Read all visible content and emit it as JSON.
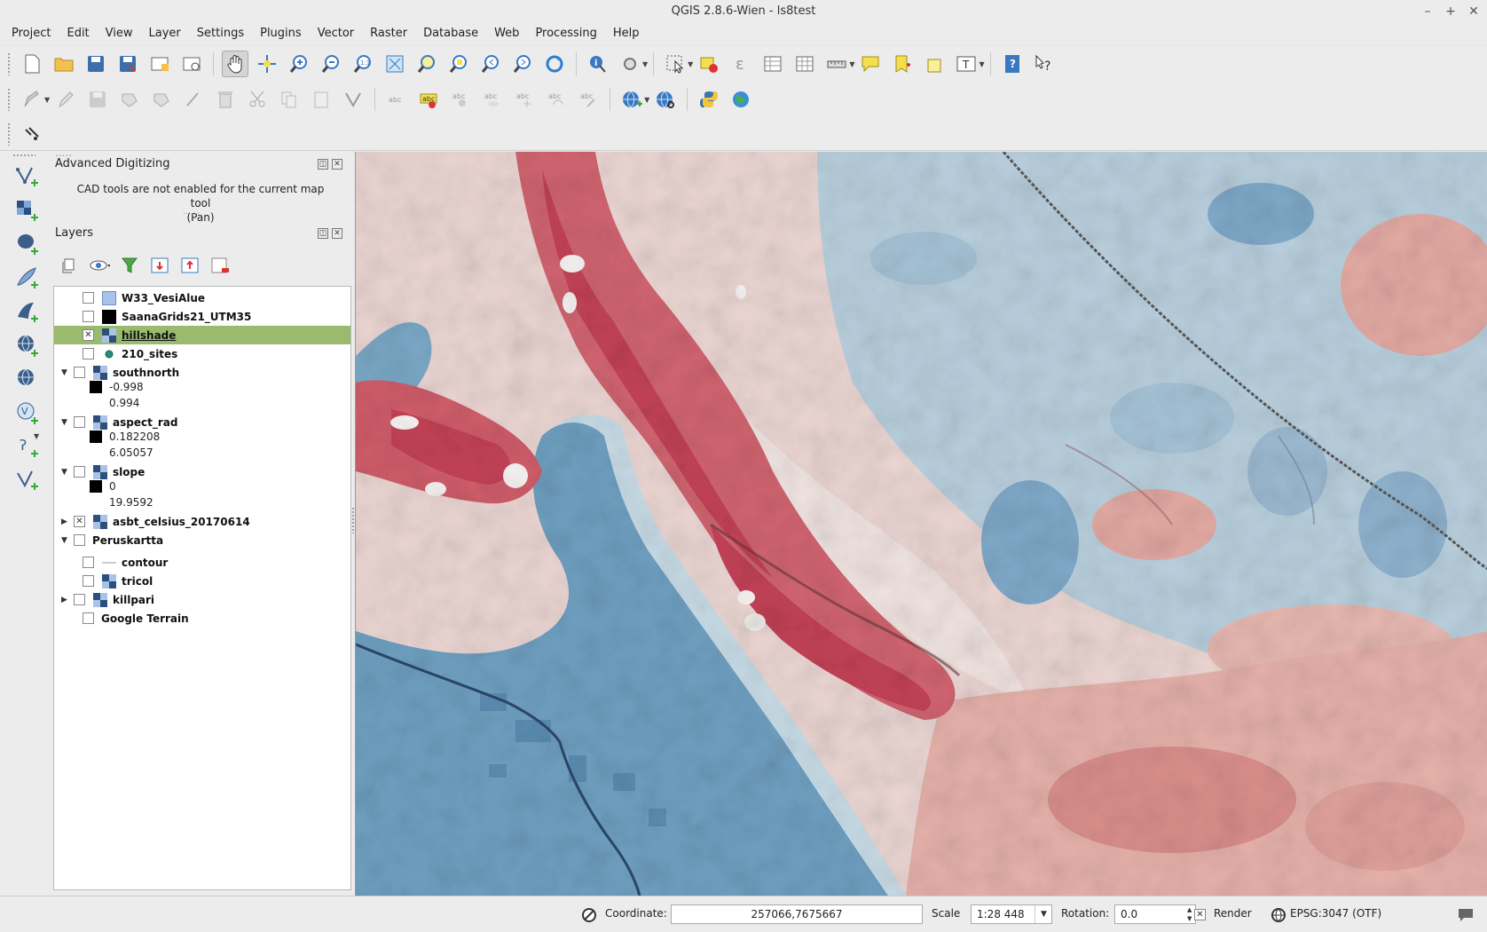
{
  "window": {
    "title": "QGIS 2.8.6-Wien - ls8test"
  },
  "menubar": [
    "Project",
    "Edit",
    "View",
    "Layer",
    "Settings",
    "Plugins",
    "Vector",
    "Raster",
    "Database",
    "Web",
    "Processing",
    "Help"
  ],
  "advanced_digitizing": {
    "title": "Advanced Digitizing",
    "message_line1": "CAD tools are not enabled for the current map tool",
    "message_line2": "(Pan)"
  },
  "layers_panel": {
    "title": "Layers",
    "layers": [
      {
        "name": "W33_VesiAlue",
        "checked": false,
        "icon": "polygon-icon",
        "icon_color": "#a9c3e8"
      },
      {
        "name": "SaanaGrids21_UTM35",
        "checked": false,
        "icon": "polygon-icon",
        "icon_color": "#000000"
      },
      {
        "name": "hillshade",
        "checked": true,
        "icon": "raster-icon",
        "selected": true
      },
      {
        "name": "210_sites",
        "checked": false,
        "icon": "point-icon"
      },
      {
        "name": "southnorth",
        "checked": false,
        "icon": "raster-icon",
        "expanded": true,
        "legend": [
          "-0.998",
          "0.994"
        ]
      },
      {
        "name": "aspect_rad",
        "checked": false,
        "icon": "raster-icon",
        "expanded": true,
        "legend": [
          "0.182208",
          "6.05057"
        ]
      },
      {
        "name": "slope",
        "checked": false,
        "icon": "raster-icon",
        "expanded": true,
        "legend": [
          "0",
          "19.9592"
        ]
      },
      {
        "name": "asbt_celsius_20170614",
        "checked": true,
        "icon": "raster-icon",
        "collapsed": true
      },
      {
        "name": "Peruskartta",
        "checked": false,
        "group": true,
        "expanded": true
      },
      {
        "name": "contour",
        "checked": false,
        "icon": "line-icon",
        "child": true
      },
      {
        "name": "tricol",
        "checked": false,
        "icon": "raster-icon",
        "child": true
      },
      {
        "name": "killpari",
        "checked": false,
        "icon": "raster-icon",
        "child": true,
        "collapsed": true
      },
      {
        "name": "Google Terrain",
        "checked": false,
        "child": true
      }
    ]
  },
  "statusbar": {
    "coordinate_label": "Coordinate:",
    "coordinate_value": "257066,7675667",
    "scale_label": "Scale",
    "scale_value": "1:28 448",
    "rotation_label": "Rotation:",
    "rotation_value": "0.0",
    "render_label": "Render",
    "crs": "EPSG:3047 (OTF)"
  },
  "colors": {
    "selected_row": "#9aba6e",
    "map_water": "#6f9fc0",
    "map_warm": "#c8404f",
    "map_light": "#ecdcd8"
  }
}
